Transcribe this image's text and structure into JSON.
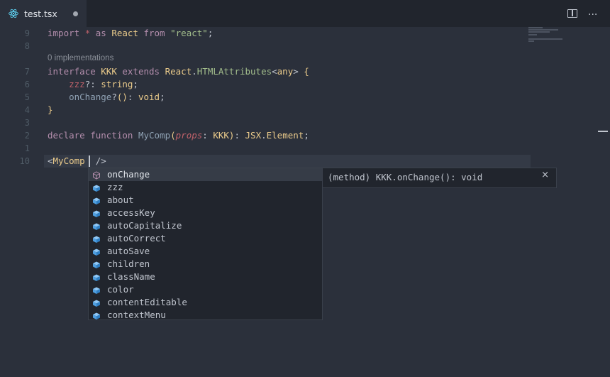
{
  "tab": {
    "title": "test.tsx",
    "icon": "react-icon",
    "modified": true
  },
  "toolbar": {
    "split_icon": "split-editor-icon",
    "more_icon": "more-actions-icon",
    "more_label": "···"
  },
  "codelens": "0 implementations",
  "lines": [
    {
      "number": "9",
      "tokens": [
        [
          "kw",
          "import "
        ],
        [
          "opt",
          "* "
        ],
        [
          "kw",
          "as "
        ],
        [
          "ty",
          "React "
        ],
        [
          "kw",
          "from "
        ],
        [
          "str",
          "\"react\""
        ],
        [
          "pun",
          ";"
        ]
      ]
    },
    {
      "number": "8",
      "tokens": []
    },
    {
      "number": "7",
      "tokens": [
        [
          "kw",
          "interface "
        ],
        [
          "ty",
          "KKK "
        ],
        [
          "kw",
          "extends "
        ],
        [
          "ty",
          "React"
        ],
        [
          "pun",
          "."
        ],
        [
          "str",
          "HTMLAttributes"
        ],
        [
          "pun",
          "<"
        ],
        [
          "ty",
          "any"
        ],
        [
          "pun",
          "> "
        ],
        [
          "ty",
          "{"
        ]
      ]
    },
    {
      "number": "6",
      "tokens": [
        [
          "pun",
          "    "
        ],
        [
          "opt",
          "zzz"
        ],
        [
          "pun",
          "?: "
        ],
        [
          "ty",
          "string"
        ],
        [
          "pun",
          ";"
        ]
      ]
    },
    {
      "number": "5",
      "tokens": [
        [
          "pun",
          "    "
        ],
        [
          "fn",
          "onChange"
        ],
        [
          "pun",
          "?"
        ],
        [
          "ty",
          "()"
        ],
        [
          "pun",
          ": "
        ],
        [
          "ty",
          "void"
        ],
        [
          "pun",
          ";"
        ]
      ]
    },
    {
      "number": "4",
      "tokens": [
        [
          "ty",
          "}"
        ]
      ]
    },
    {
      "number": "3",
      "tokens": []
    },
    {
      "number": "2",
      "tokens": [
        [
          "kw",
          "declare "
        ],
        [
          "kw",
          "function "
        ],
        [
          "fn",
          "MyComp"
        ],
        [
          "ty",
          "("
        ],
        [
          "prm",
          "props"
        ],
        [
          "pun",
          ": "
        ],
        [
          "ty",
          "KKK"
        ],
        [
          "ty",
          ")"
        ],
        [
          "pun",
          ": "
        ],
        [
          "ty",
          "JSX"
        ],
        [
          "pun",
          "."
        ],
        [
          "ty",
          "Element"
        ],
        [
          "pun",
          ";"
        ]
      ]
    },
    {
      "number": "1",
      "tokens": []
    },
    {
      "number": "10",
      "tokens": [
        [
          "pun",
          "<"
        ],
        [
          "tag",
          "MyComp "
        ],
        [
          "pun",
          " />"
        ]
      ]
    }
  ],
  "suggest": {
    "items": [
      {
        "label": "onChange",
        "kind": "method-icon",
        "selected": true
      },
      {
        "label": "zzz",
        "kind": "property-icon"
      },
      {
        "label": "about",
        "kind": "property-icon"
      },
      {
        "label": "accessKey",
        "kind": "property-icon"
      },
      {
        "label": "autoCapitalize",
        "kind": "property-icon"
      },
      {
        "label": "autoCorrect",
        "kind": "property-icon"
      },
      {
        "label": "autoSave",
        "kind": "property-icon"
      },
      {
        "label": "children",
        "kind": "property-icon"
      },
      {
        "label": "className",
        "kind": "property-icon"
      },
      {
        "label": "color",
        "kind": "property-icon"
      },
      {
        "label": "contentEditable",
        "kind": "property-icon"
      },
      {
        "label": "contextMenu",
        "kind": "property-icon"
      }
    ]
  },
  "details": {
    "text": "(method) KKK.onChange(): void",
    "close_label": "×"
  },
  "colors": {
    "background": "#2b303b",
    "panel": "#21252d",
    "accent": "#61dafb"
  }
}
